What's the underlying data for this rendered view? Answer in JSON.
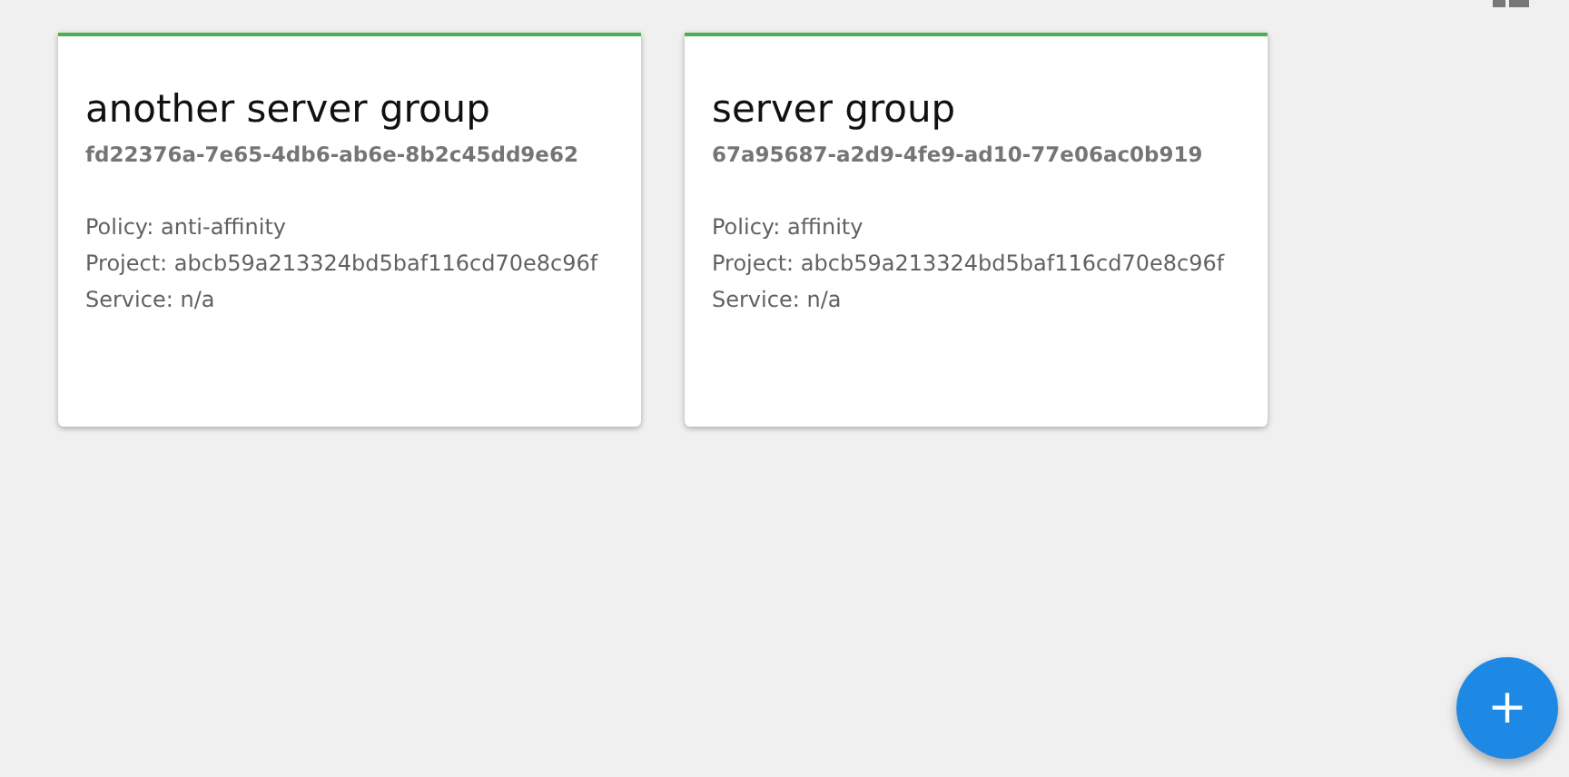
{
  "cards": [
    {
      "name": "another server group",
      "id": "fd22376a-7e65-4db6-ab6e-8b2c45dd9e62",
      "details": [
        "Policy: anti-affinity",
        "Project: abcb59a213324bd5baf116cd70e8c96f",
        "Service: n/a"
      ]
    },
    {
      "name": "server group",
      "id": "67a95687-a2d9-4fe9-ad10-77e06ac0b919",
      "details": [
        "Policy: affinity",
        "Project: abcb59a213324bd5baf116cd70e8c96f",
        "Service: n/a"
      ]
    }
  ],
  "fab": {
    "label": "+"
  }
}
